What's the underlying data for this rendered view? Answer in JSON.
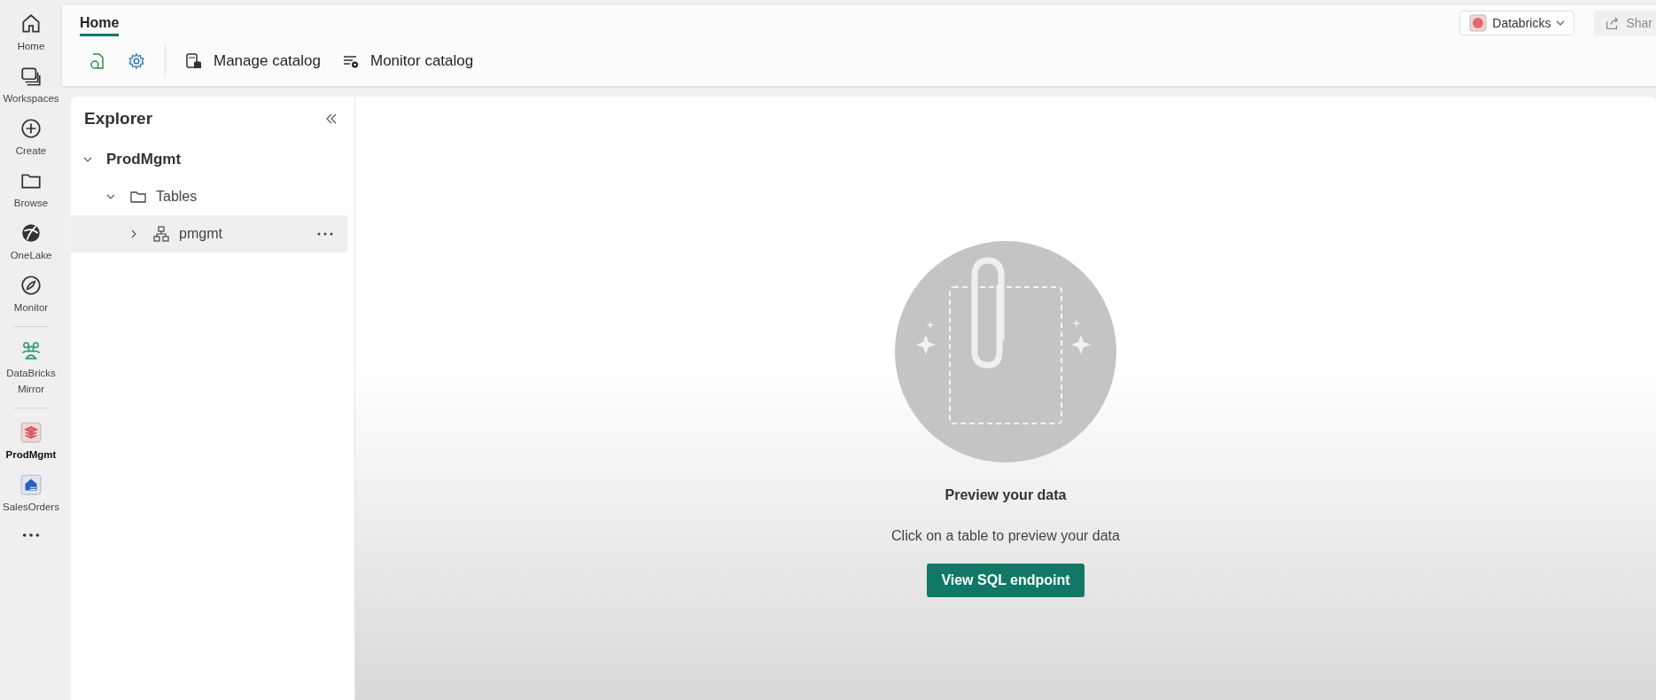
{
  "nav_rail": [
    {
      "label": "Home",
      "selected": false
    },
    {
      "label": "Workspaces",
      "selected": false
    },
    {
      "label": "Create",
      "selected": false
    },
    {
      "label": "Browse",
      "selected": false
    },
    {
      "label": "OneLake",
      "selected": false
    },
    {
      "label": "Monitor",
      "selected": false
    },
    {
      "label": "DataBricks Mirror",
      "selected": false
    },
    {
      "label": "ProdMgmt",
      "selected": true
    },
    {
      "label": "SalesOrders",
      "selected": false
    }
  ],
  "tabs": [
    {
      "label": "Home",
      "selected": true
    }
  ],
  "toolbar": [
    {
      "label": "Manage catalog"
    },
    {
      "label": "Monitor catalog"
    }
  ],
  "workspace_button": {
    "label": "Databricks"
  },
  "share_button": {
    "label": "Shar",
    "disabled": true
  },
  "explorer": {
    "title": "Explorer",
    "tree": [
      {
        "label": "ProdMgmt",
        "kind": "root",
        "expanded": true,
        "selected": false,
        "children": [
          {
            "label": "Tables",
            "kind": "folder",
            "expanded": true,
            "selected": false,
            "children": [
              {
                "label": "pmgmt",
                "kind": "table",
                "expanded": false,
                "selected": true
              }
            ]
          }
        ]
      }
    ]
  },
  "empty_state": {
    "title": "Preview your data",
    "message": "Click on a table to preview your data",
    "button": "View SQL endpoint"
  }
}
